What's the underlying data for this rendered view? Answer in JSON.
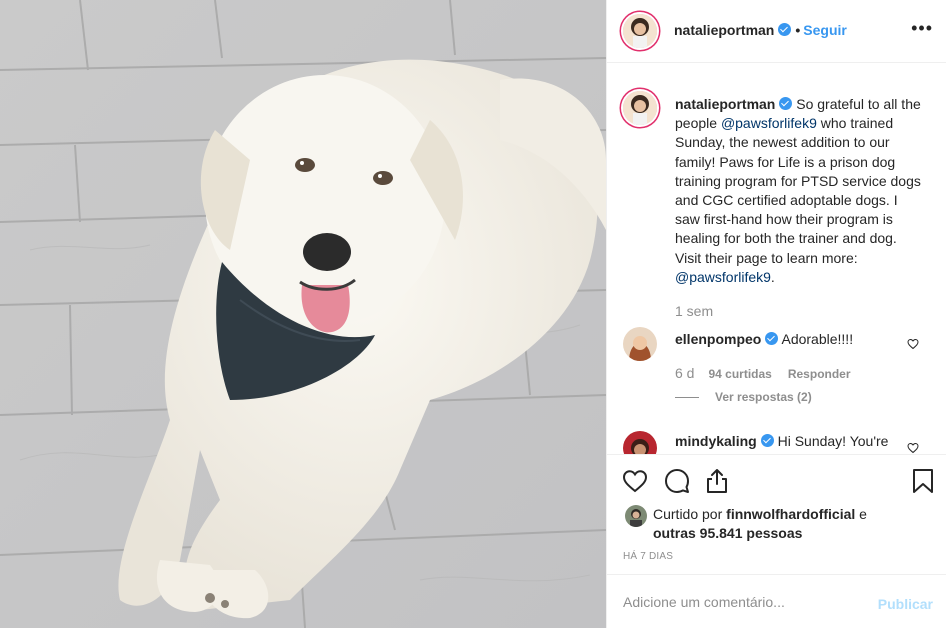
{
  "post": {
    "author": "natalieportman",
    "follow_label": "Seguir",
    "dot": "•",
    "more_label": "•••"
  },
  "caption": {
    "user": "natalieportman",
    "part1": "So grateful to all the people ",
    "mention1": "@pawsforlifek9",
    "part2": " who trained Sunday, the newest addition to our family! Paws for Life is a prison dog training program for PTSD service dogs and CGC certified adoptable dogs. I saw first-hand how their program is healing for both the trainer and dog. Visit their page to learn more: ",
    "mention2": "@pawsforlifek9",
    "part3": ".",
    "time": "1 sem"
  },
  "comments": [
    {
      "user": "ellenpompeo",
      "text": "Adorable!!!!",
      "time": "6 d",
      "likes": "94 curtidas",
      "reply_label": "Responder",
      "view_replies": "Ver respostas (2)"
    },
    {
      "user": "mindykaling",
      "text": "Hi Sunday! You're"
    }
  ],
  "likes": {
    "prefix": "Curtido por ",
    "user": "finnwolfhardofficial",
    "middle": " e ",
    "others": "outras 95.841 pessoas"
  },
  "ago": "HÁ 7 DIAS",
  "add_comment": {
    "placeholder": "Adicione um comentário...",
    "post_label": "Publicar"
  },
  "colors": {
    "accent": "#3897f0",
    "muted": "#8e8e8e",
    "publish_disabled": "#b2dffc",
    "story_ring": "#e1306c"
  },
  "icons": [
    "heart-icon",
    "comment-icon",
    "share-icon",
    "bookmark-icon",
    "verified-icon",
    "more-options-icon"
  ]
}
